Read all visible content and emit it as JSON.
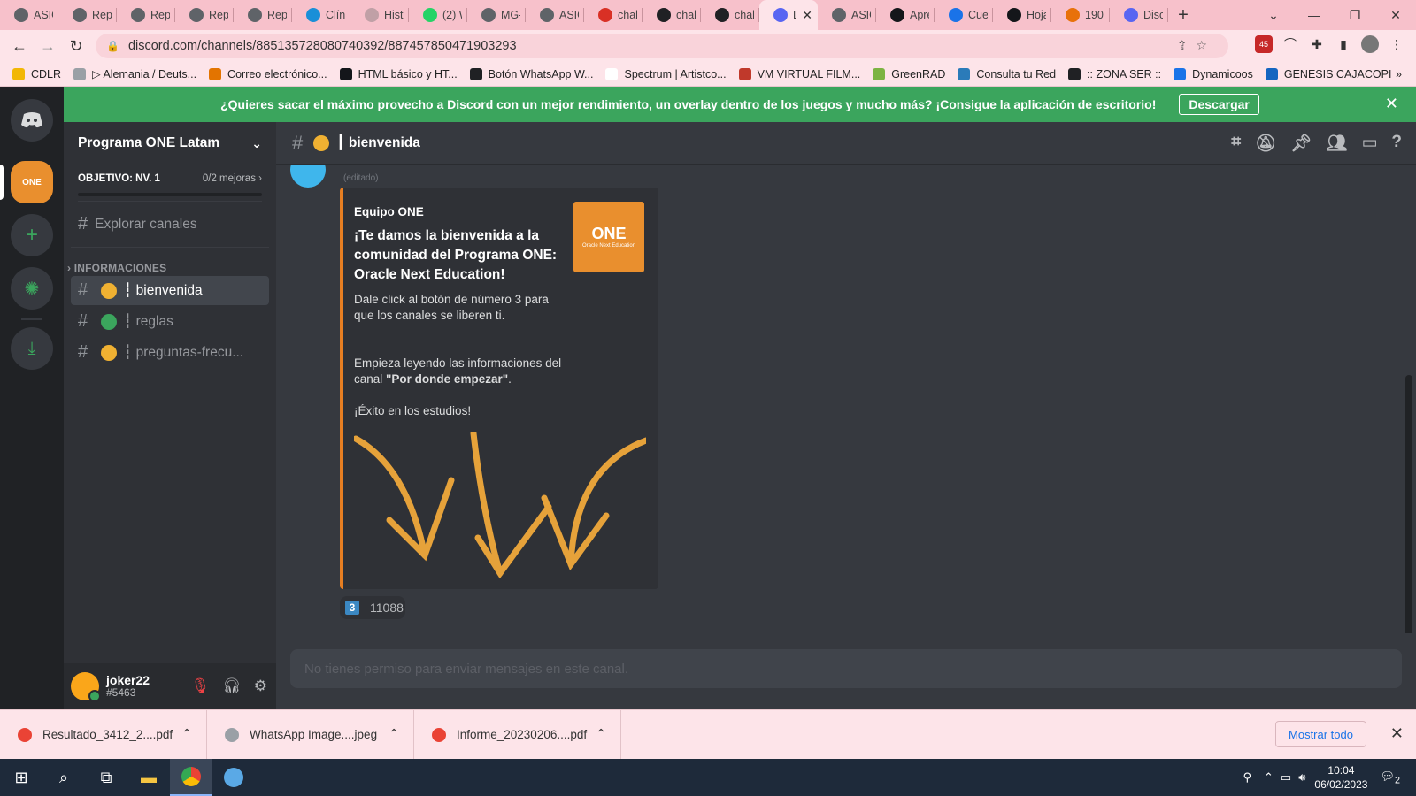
{
  "browser": {
    "tabs": [
      {
        "title": "ASIG",
        "color": "#5f6368"
      },
      {
        "title": "Repo",
        "color": "#5f6368"
      },
      {
        "title": "Repo",
        "color": "#5f6368"
      },
      {
        "title": "Repo",
        "color": "#5f6368"
      },
      {
        "title": "Repo",
        "color": "#5f6368"
      },
      {
        "title": "Clíni",
        "color": "#1a8fd8"
      },
      {
        "title": "Histo",
        "color": "#c0a0a6"
      },
      {
        "title": "(2) W",
        "color": "#25d366"
      },
      {
        "title": "MG-",
        "color": "#5f6368"
      },
      {
        "title": "ASIG",
        "color": "#5f6368"
      },
      {
        "title": "chall",
        "color": "#d93025"
      },
      {
        "title": "chall",
        "color": "#202124"
      },
      {
        "title": "chall",
        "color": "#202124"
      },
      {
        "title": "D",
        "color": "#5865f2",
        "active": true
      },
      {
        "title": "ASIG",
        "color": "#5f6368"
      },
      {
        "title": "Apre",
        "color": "#14161a"
      },
      {
        "title": "Cuer",
        "color": "#1a73e8"
      },
      {
        "title": "Hoja",
        "color": "#14161a"
      },
      {
        "title": "190.",
        "color": "#e8710a"
      },
      {
        "title": "Disc",
        "color": "#5865f2"
      }
    ],
    "url": "discord.com/channels/885135728080740392/887457850471903293",
    "bookmarks": [
      {
        "label": "CDLR",
        "color": "#f2b705"
      },
      {
        "label": "▷ Alemania / Deuts...",
        "color": "#9aa0a6"
      },
      {
        "label": "Correo electrónico...",
        "color": "#e37400"
      },
      {
        "label": "HTML básico y HT...",
        "color": "#14161a"
      },
      {
        "label": "Botón WhatsApp W...",
        "color": "#202124"
      },
      {
        "label": "Spectrum | Artistco...",
        "color": "#ffffff"
      },
      {
        "label": "VM VIRTUAL FILM...",
        "color": "#c0392b"
      },
      {
        "label": "GreenRAD",
        "color": "#7cb342"
      },
      {
        "label": "Consulta tu Red",
        "color": "#2b7bb9"
      },
      {
        "label": ":: ZONA SER ::",
        "color": "#202124"
      },
      {
        "label": "Dynamicoos",
        "color": "#1a73e8"
      },
      {
        "label": "GENESIS CAJACOPI",
        "color": "#1565c0"
      }
    ],
    "ext_badge": "45"
  },
  "discord": {
    "banner": {
      "text": "¿Quieres sacar el máximo provecho a Discord con un mejor rendimiento, un overlay dentro de los juegos y mucho más? ¡Consigue la aplicación de escritorio!",
      "button": "Descargar"
    },
    "server": {
      "name": "Programa ONE Latam",
      "goal_label": "OBJETIVO: NV. 1",
      "goal_progress": "0/2 mejoras",
      "goal_fraction": 0,
      "explore": "Explorar canales",
      "category": "INFORMACIONES",
      "channels": [
        {
          "name": "┆ bienvenida",
          "emoji_color": "#f0b132",
          "selected": true
        },
        {
          "name": "┆ reglas",
          "emoji_color": "#3ba55d"
        },
        {
          "name": "┆ preguntas-frecu...",
          "emoji_color": "#f0b132"
        }
      ]
    },
    "user": {
      "name": "joker22",
      "tag": "#5463"
    },
    "channel_header": {
      "name": "┃ bienvenida"
    },
    "message": {
      "edited": "(editado)",
      "embed": {
        "author": "Equipo ONE",
        "title": "¡Te damos la bienvenida a la comunidad del Programa ONE: Oracle Next Education!",
        "desc1": "Dale click al botón de número 3 para que los canales se liberen ti.",
        "desc2a": "Empieza leyendo las informaciones del canal ",
        "desc2b": "\"Por donde empezar\"",
        "desc2c": ".",
        "desc3": "¡Éxito en los estudios!",
        "thumb_brand": "ONE",
        "thumb_sub": "Oracle Next Education"
      },
      "reaction": {
        "emoji": "3",
        "count": "11088"
      }
    },
    "composer_placeholder": "No tienes permiso para enviar mensajes en este canal."
  },
  "downloads": {
    "items": [
      {
        "name": "Resultado_3412_2....pdf",
        "color": "#ea4335"
      },
      {
        "name": "WhatsApp Image....jpeg",
        "color": "#9aa0a6"
      },
      {
        "name": "Informe_20230206....pdf",
        "color": "#ea4335"
      }
    ],
    "show_all": "Mostrar todo"
  },
  "taskbar": {
    "time": "10:04",
    "date": "06/02/2023",
    "notif": "2"
  },
  "colors": {
    "accent_green": "#3ba55d",
    "embed_orange": "#e67e22",
    "discord_blurple": "#5865f2"
  }
}
